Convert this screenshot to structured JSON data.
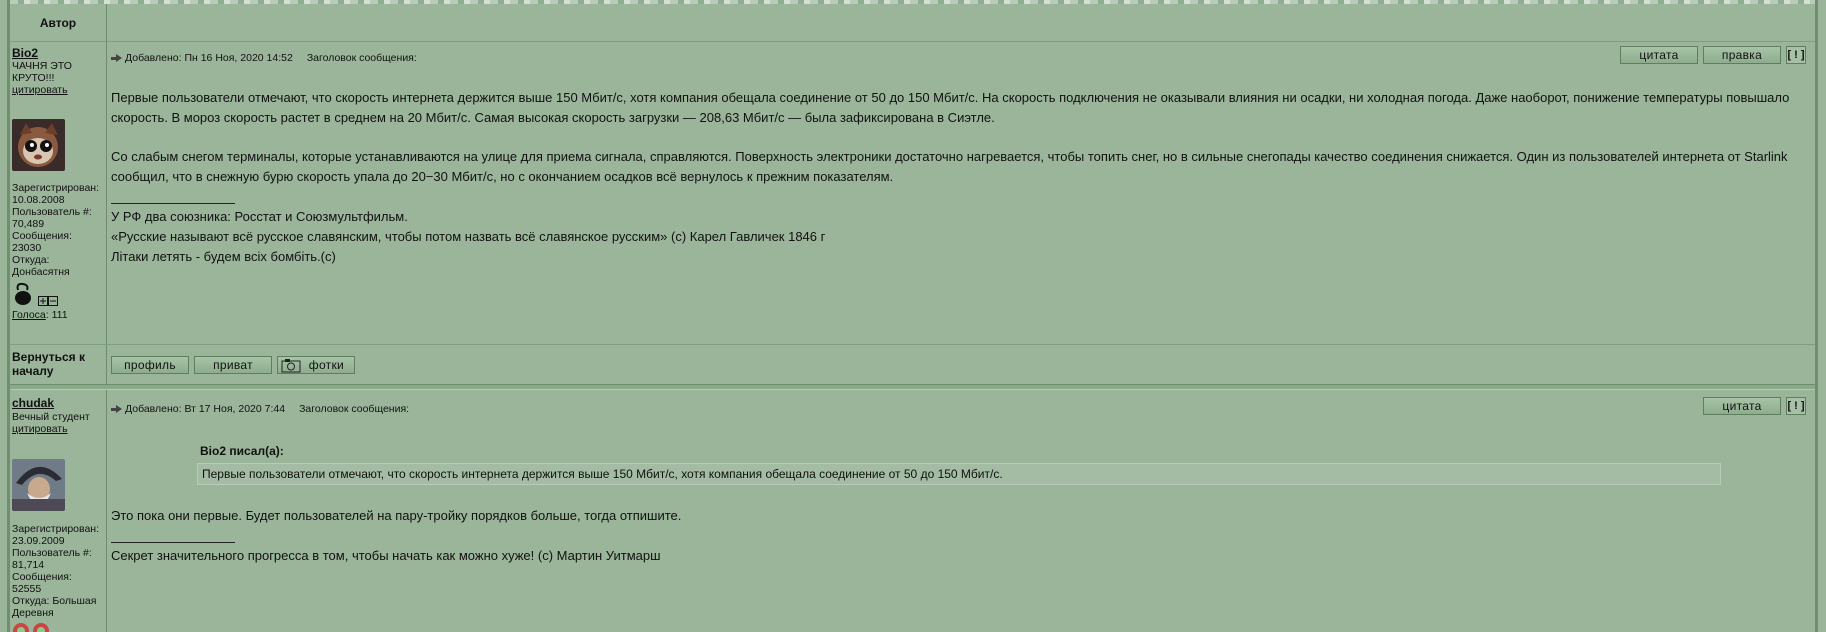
{
  "header": {
    "author_col": "Автор"
  },
  "posts": [
    {
      "username": "Bio2",
      "rank": "ЧАЧНЯ ЭТО КРУТО!!!",
      "quote_link": "цитировать",
      "registered_label": "Зарегистрирован:",
      "registered": "10.08.2008",
      "usernum_label": "Пользователь #:",
      "usernum": "70,489",
      "messages_label": "Сообщения:",
      "messages": "23030",
      "from_label": "Откуда:",
      "from": "Донбасятня",
      "votes_label": "Голоса",
      "votes": ": 111",
      "meta_added": "Добавлено: Пн 16 Ноя, 2020 14:52",
      "meta_subject": "Заголовок сообщения:",
      "btn_quote": "цитата",
      "btn_edit": "правка",
      "btn_report": "[ ! ]",
      "p1": "Первые пользователи отмечают, что скорость интернета держится выше 150 Мбит/с, хотя компания обещала соединение от 50 до 150 Мбит/с. На скорость подключения не оказывали влияния ни осадки, ни холодная погода. Даже наоборот, понижение температуры повышало скорость. В мороз скорость растет в среднем на 20 Мбит/с. Самая высокая скорость загрузки — 208,63 Мбит/с — была зафиксирована в Сиэтле.",
      "p2": "Со слабым снегом терминалы, которые устанавливаются на улице для приема сигнала, справляются. Поверхность электроники достаточно нагревается, чтобы топить снег, но в сильные снегопады качество соединения снижается. Один из пользователей интернета от Starlink сообщил, что в снежную бурю скорость упала до 20−30 Мбит/с, но с окончанием осадков всё вернулось к прежним показателям.",
      "sig1": "У РФ два союзника: Росстат и Союзмультфильм.",
      "sig2": "«Русские называют всё русское славянским, чтобы потом назвать всё славянское русским» (с) Карел Гавличек 1846 г",
      "sig3": "Літаки летять - будем всіх бомбіть.(с)"
    },
    {
      "username": "chudak",
      "rank": "Вечный студент",
      "quote_link": "цитировать",
      "registered_label": "Зарегистрирован:",
      "registered": "23.09.2009",
      "usernum_label": "Пользователь #:",
      "usernum": "81,714",
      "messages_label": "Сообщения:",
      "messages": "52555",
      "from_label": "Откуда:",
      "from": "Большая Деревня",
      "meta_added": "Добавлено: Вт 17 Ноя, 2020 7:44",
      "meta_subject": "Заголовок сообщения:",
      "btn_quote": "цитата",
      "btn_report": "[ ! ]",
      "quote_title": "Bio2 писал(а):",
      "quote_text": "Первые пользователи отмечают, что скорость интернета держится выше 150 Мбит/с, хотя компания обещала соединение от 50 до 150 Мбит/с.",
      "p1": "Это пока они первые. Будет пользователей на пару-тройку порядков больше, тогда отпишите.",
      "sig1": "Секрет значительного прогресса в том, чтобы начать как можно хуже! (с) Мартин Уитмарш"
    }
  ],
  "footer_row": {
    "back_to_top": "Вернуться к началу",
    "btn_profile": "профиль",
    "btn_private": "приват",
    "btn_photos": "фотки"
  }
}
